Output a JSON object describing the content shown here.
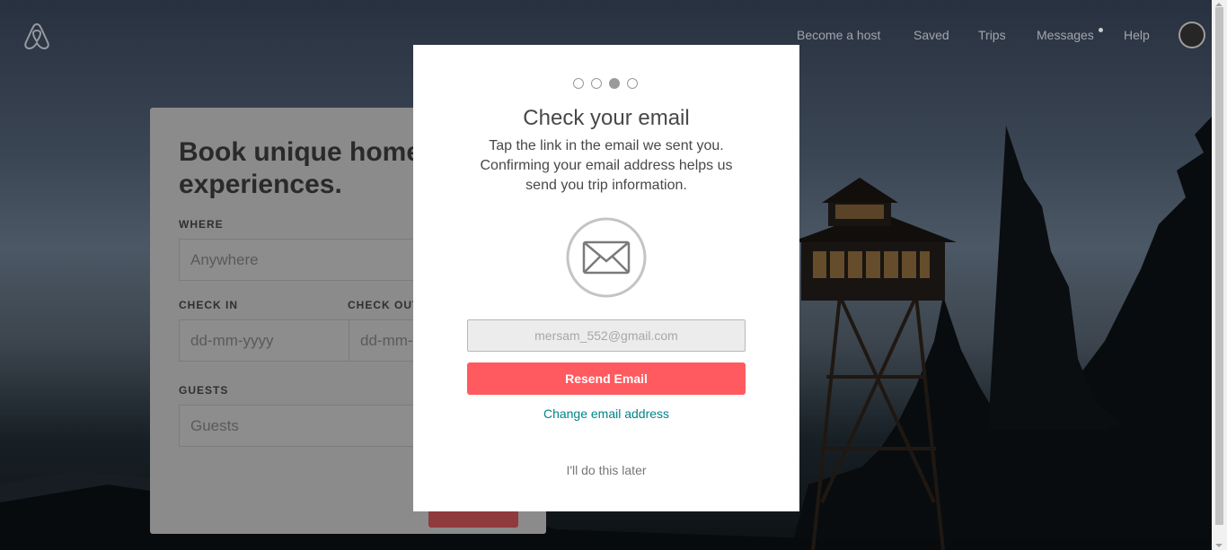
{
  "header": {
    "nav": [
      {
        "label": "Become a host"
      },
      {
        "label": "Saved"
      },
      {
        "label": "Trips"
      },
      {
        "label": "Messages"
      },
      {
        "label": "Help"
      }
    ]
  },
  "search_card": {
    "title": "Book unique homes and experiences.",
    "where": {
      "label": "WHERE",
      "placeholder": "Anywhere"
    },
    "check_in": {
      "label": "CHECK IN",
      "placeholder": "dd-mm-yyyy"
    },
    "check_out": {
      "label": "CHECK OUT",
      "placeholder": "dd-mm-yyyy"
    },
    "guests": {
      "label": "GUESTS",
      "placeholder": "Guests"
    }
  },
  "modal": {
    "steps_total": 4,
    "active_step": 3,
    "title": "Check your email",
    "description": "Tap the link in the email we sent you. Confirming your email address helps us send you trip information.",
    "email_value": "mersam_552@gmail.com",
    "resend_label": "Resend Email",
    "change_label": "Change email address",
    "later_label": "I'll do this later"
  },
  "colors": {
    "brand": "#ff5a5f",
    "link": "#008489"
  }
}
